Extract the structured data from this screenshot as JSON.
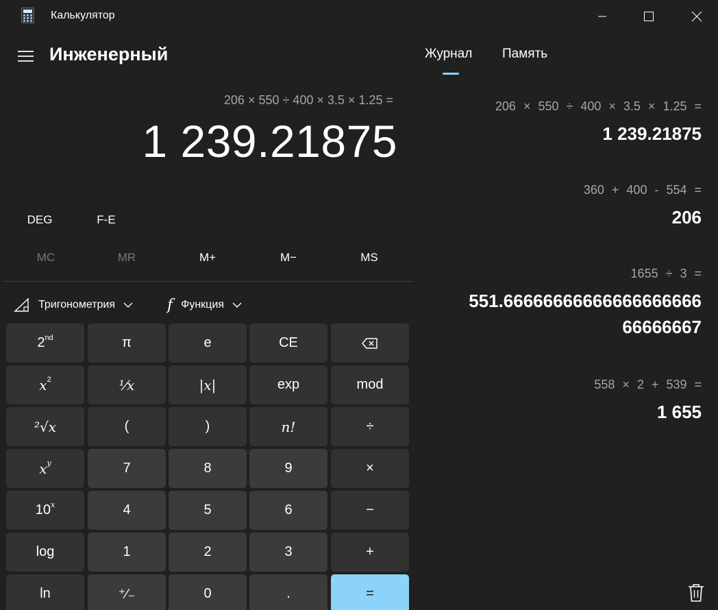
{
  "window": {
    "title": "Калькулятор",
    "icon": "calculator-icon"
  },
  "header": {
    "mode_title": "Инженерный"
  },
  "display": {
    "expression": "206 × 550 ÷ 400 × 3.5 × 1.25 =",
    "result": "1 239.21875"
  },
  "modes": {
    "angle": "DEG",
    "notation": "F-E"
  },
  "memory_buttons": [
    {
      "label": "MC",
      "enabled": false
    },
    {
      "label": "MR",
      "enabled": false
    },
    {
      "label": "M+",
      "enabled": true
    },
    {
      "label": "M−",
      "enabled": true
    },
    {
      "label": "MS",
      "enabled": true
    }
  ],
  "dropdowns": {
    "trig": "Тригонометрия",
    "func": "Функция"
  },
  "keys": {
    "second": "2",
    "second_sup": "nd",
    "pi": "π",
    "e": "e",
    "ce": "CE",
    "x_sq_base": "x",
    "x_sq_exp": "2",
    "reciprocal": "⅟x",
    "abs": "|x|",
    "exp": "exp",
    "mod": "mod",
    "sqrt": "²√x",
    "lparen": "(",
    "rparen": ")",
    "fact": "n!",
    "divide": "÷",
    "x_pow_base": "x",
    "x_pow_exp": "y",
    "d7": "7",
    "d8": "8",
    "d9": "9",
    "multiply": "×",
    "ten_base": "10",
    "ten_exp": "x",
    "d4": "4",
    "d5": "5",
    "d6": "6",
    "minus": "−",
    "log": "log",
    "d1": "1",
    "d2": "2",
    "d3": "3",
    "plus": "+",
    "ln": "ln",
    "negate": "⁺∕₋",
    "d0": "0",
    "decimal": ".",
    "equals": "="
  },
  "panel": {
    "tab_history": "Журнал",
    "tab_memory": "Память",
    "history": [
      {
        "expression": "206 × 550 ÷ 400 × 3.5 × 1.25 =",
        "result": "1 239.21875"
      },
      {
        "expression": "360 + 400 - 554 =",
        "result": "206"
      },
      {
        "expression": "1655 ÷ 3 =",
        "result_line1": "551.66666666666666666666",
        "result_line2": "66666667"
      },
      {
        "expression": "558 × 2 + 539 =",
        "result": "1 655"
      }
    ]
  },
  "colors": {
    "background": "#202020",
    "key_number": "#3b3b3b",
    "key_function": "#323232",
    "accent": "#8bd3f9"
  }
}
